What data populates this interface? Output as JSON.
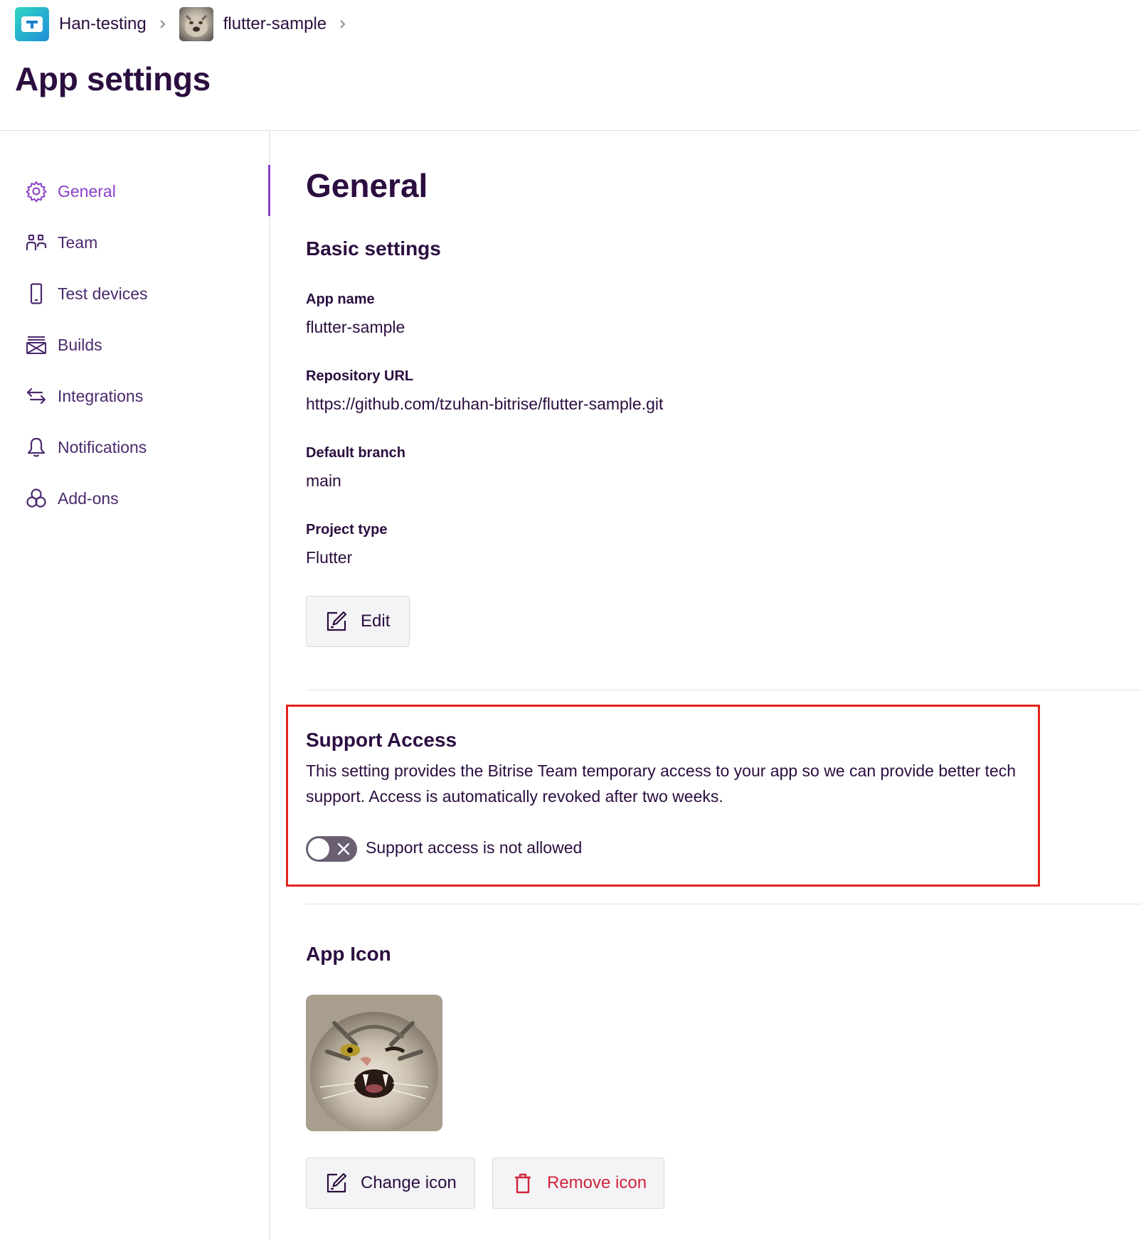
{
  "breadcrumb": {
    "org": "Han-testing",
    "app": "flutter-sample"
  },
  "page": {
    "title": "App settings"
  },
  "sidebar": {
    "items": [
      {
        "label": "General",
        "icon": "gear-icon",
        "active": true
      },
      {
        "label": "Team",
        "icon": "team-icon",
        "active": false
      },
      {
        "label": "Test devices",
        "icon": "phone-icon",
        "active": false
      },
      {
        "label": "Builds",
        "icon": "builds-icon",
        "active": false
      },
      {
        "label": "Integrations",
        "icon": "integrations-icon",
        "active": false
      },
      {
        "label": "Notifications",
        "icon": "bell-icon",
        "active": false
      },
      {
        "label": "Add-ons",
        "icon": "addons-icon",
        "active": false
      }
    ]
  },
  "main": {
    "title": "General",
    "basic": {
      "title": "Basic settings",
      "app_name_label": "App name",
      "app_name": "flutter-sample",
      "repo_label": "Repository URL",
      "repo_url": "https://github.com/tzuhan-bitrise/flutter-sample.git",
      "branch_label": "Default branch",
      "branch": "main",
      "type_label": "Project type",
      "type": "Flutter",
      "edit_label": "Edit"
    },
    "support": {
      "title": "Support Access",
      "description": "This setting provides the Bitrise Team temporary access to your app so we can provide better tech support. Access is automatically revoked after two weeks.",
      "toggle_label": "Support access is not allowed",
      "enabled": false
    },
    "icon": {
      "title": "App Icon",
      "change_label": "Change icon",
      "remove_label": "Remove icon"
    }
  },
  "colors": {
    "text": "#2b0e3f",
    "accent": "#8a3fc8",
    "danger": "#d2223c",
    "highlight": "#e3241b"
  }
}
